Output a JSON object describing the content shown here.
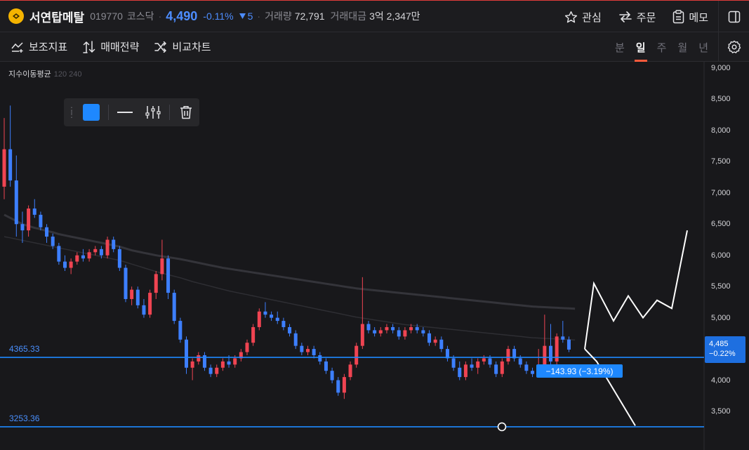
{
  "header": {
    "stock_name": "서연탑메탈",
    "stock_code": "019770",
    "market": "코스닥",
    "price": "4,490",
    "change_pct": "-0.11%",
    "change_val": "5",
    "volume_label": "거래량",
    "volume": "72,791",
    "amount_label": "거래대금",
    "amount": "3억 2,347만",
    "actions": {
      "watch": "관심",
      "order": "주문",
      "memo": "메모"
    }
  },
  "toolbar": {
    "indicators": "보조지표",
    "strategy": "매매전략",
    "compare": "비교차트",
    "periods": [
      "분",
      "일",
      "주",
      "월",
      "년"
    ],
    "active_period": "일"
  },
  "chart": {
    "indicator_name": "지수이동평균",
    "indicator_params": "120 240",
    "level_upper": "4365.33",
    "level_lower": "3253.36",
    "current_price": "4,485",
    "current_pct": "−0.22%",
    "measure": "−143.93 (−3.19%)",
    "draw_color": "#1e88ff"
  },
  "chart_data": {
    "type": "candlestick",
    "y_ticks": [
      "9,000",
      "8,500",
      "8,000",
      "7,500",
      "7,000",
      "6,500",
      "6,000",
      "5,500",
      "5,000",
      "4,500",
      "4,000",
      "3,500"
    ],
    "ylim": [
      3200,
      9000
    ],
    "up_color": "#f04452",
    "down_color": "#3d7fff",
    "candles": [
      [
        7100,
        8200,
        6900,
        7700
      ],
      [
        7700,
        8400,
        7100,
        7200
      ],
      [
        7200,
        7600,
        6300,
        6500
      ],
      [
        6500,
        6700,
        6200,
        6400
      ],
      [
        6400,
        6800,
        6300,
        6750
      ],
      [
        6750,
        6900,
        6600,
        6650
      ],
      [
        6650,
        6700,
        6400,
        6450
      ],
      [
        6450,
        6500,
        6200,
        6300
      ],
      [
        6300,
        6350,
        6100,
        6150
      ],
      [
        6150,
        6200,
        5850,
        5900
      ],
      [
        5900,
        6000,
        5750,
        5800
      ],
      [
        5800,
        5950,
        5700,
        5900
      ],
      [
        5900,
        6050,
        5850,
        6000
      ],
      [
        6000,
        6100,
        5900,
        5950
      ],
      [
        5950,
        6100,
        5900,
        6050
      ],
      [
        6050,
        6150,
        6000,
        6100
      ],
      [
        6100,
        6150,
        5950,
        6000
      ],
      [
        6000,
        6300,
        5950,
        6250
      ],
      [
        6250,
        6300,
        6050,
        6100
      ],
      [
        6100,
        6150,
        5750,
        5800
      ],
      [
        5800,
        5850,
        5250,
        5300
      ],
      [
        5300,
        5500,
        5200,
        5450
      ],
      [
        5450,
        5500,
        5150,
        5200
      ],
      [
        5200,
        5300,
        5000,
        5050
      ],
      [
        5050,
        5450,
        5000,
        5400
      ],
      [
        5400,
        5750,
        5300,
        5700
      ],
      [
        5700,
        6250,
        5600,
        5950
      ],
      [
        5950,
        6000,
        5300,
        5400
      ],
      [
        5400,
        5450,
        4900,
        4950
      ],
      [
        4950,
        5000,
        4600,
        4650
      ],
      [
        4650,
        4700,
        4100,
        4200
      ],
      [
        4200,
        4350,
        4000,
        4300
      ],
      [
        4300,
        4450,
        4250,
        4400
      ],
      [
        4400,
        4450,
        4150,
        4200
      ],
      [
        4200,
        4250,
        4050,
        4100
      ],
      [
        4100,
        4250,
        4050,
        4200
      ],
      [
        4200,
        4350,
        4150,
        4300
      ],
      [
        4300,
        4400,
        4200,
        4250
      ],
      [
        4250,
        4400,
        4200,
        4350
      ],
      [
        4350,
        4500,
        4300,
        4450
      ],
      [
        4450,
        4650,
        4400,
        4600
      ],
      [
        4600,
        4900,
        4550,
        4850
      ],
      [
        4850,
        5150,
        4800,
        5100
      ],
      [
        5100,
        5250,
        5000,
        5050
      ],
      [
        5050,
        5100,
        4950,
        5000
      ],
      [
        5000,
        5100,
        4900,
        4950
      ],
      [
        4950,
        5000,
        4800,
        4850
      ],
      [
        4850,
        4900,
        4700,
        4750
      ],
      [
        4750,
        4800,
        4500,
        4550
      ],
      [
        4550,
        4600,
        4400,
        4450
      ],
      [
        4450,
        4550,
        4400,
        4500
      ],
      [
        4500,
        4550,
        4350,
        4400
      ],
      [
        4400,
        4450,
        4250,
        4300
      ],
      [
        4300,
        4350,
        4100,
        4150
      ],
      [
        4150,
        4200,
        3950,
        4000
      ],
      [
        4000,
        4050,
        3750,
        3800
      ],
      [
        3800,
        4100,
        3700,
        4050
      ],
      [
        4050,
        4300,
        4000,
        4250
      ],
      [
        4250,
        4600,
        4200,
        4550
      ],
      [
        4550,
        5650,
        4500,
        4900
      ],
      [
        4900,
        4950,
        4750,
        4800
      ],
      [
        4800,
        4850,
        4700,
        4750
      ],
      [
        4750,
        4850,
        4700,
        4800
      ],
      [
        4800,
        4900,
        4750,
        4850
      ],
      [
        4850,
        4900,
        4750,
        4800
      ],
      [
        4800,
        4850,
        4650,
        4700
      ],
      [
        4700,
        4850,
        4650,
        4800
      ],
      [
        4800,
        4900,
        4750,
        4850
      ],
      [
        4850,
        4900,
        4750,
        4800
      ],
      [
        4800,
        4850,
        4700,
        4750
      ],
      [
        4750,
        4800,
        4550,
        4600
      ],
      [
        4600,
        4700,
        4550,
        4650
      ],
      [
        4650,
        4700,
        4450,
        4500
      ],
      [
        4500,
        4550,
        4300,
        4350
      ],
      [
        4350,
        4400,
        4150,
        4200
      ],
      [
        4200,
        4300,
        4000,
        4050
      ],
      [
        4050,
        4300,
        4000,
        4250
      ],
      [
        4250,
        4350,
        4150,
        4200
      ],
      [
        4200,
        4350,
        4100,
        4300
      ],
      [
        4300,
        4400,
        4250,
        4350
      ],
      [
        4350,
        4400,
        4200,
        4250
      ],
      [
        4250,
        4300,
        4050,
        4100
      ],
      [
        4100,
        4350,
        4050,
        4300
      ],
      [
        4300,
        4550,
        4250,
        4500
      ],
      [
        4500,
        4550,
        4300,
        4350
      ],
      [
        4350,
        4400,
        4200,
        4250
      ],
      [
        4250,
        4300,
        4100,
        4150
      ],
      [
        4150,
        4200,
        4050,
        4100
      ],
      [
        4100,
        4500,
        4050,
        4200
      ],
      [
        4200,
        5050,
        4150,
        4550
      ],
      [
        4550,
        4900,
        4200,
        4300
      ],
      [
        4300,
        4750,
        4250,
        4700
      ],
      [
        4700,
        4950,
        4600,
        4650
      ],
      [
        4650,
        4700,
        4450,
        4490
      ]
    ],
    "ema120": [
      6650,
      6600,
      6550,
      6500,
      6470,
      6440,
      6420,
      6390,
      6370,
      6340,
      6320,
      6300,
      6280,
      6260,
      6240,
      6220,
      6200,
      6180,
      6160,
      6140,
      6110,
      6080,
      6060,
      6040,
      6020,
      6000,
      5985,
      5970,
      5955,
      5940,
      5920,
      5900,
      5880,
      5860,
      5840,
      5820,
      5800,
      5785,
      5770,
      5755,
      5740,
      5725,
      5710,
      5695,
      5680,
      5665,
      5650,
      5635,
      5620,
      5605,
      5590,
      5575,
      5560,
      5545,
      5530,
      5515,
      5500,
      5485,
      5470,
      5460,
      5450,
      5440,
      5430,
      5420,
      5410,
      5400,
      5390,
      5380,
      5370,
      5360,
      5350,
      5340,
      5330,
      5320,
      5310,
      5300,
      5290,
      5280,
      5270,
      5260,
      5250,
      5240,
      5230,
      5220,
      5210,
      5200,
      5190,
      5180,
      5175,
      5170,
      5165,
      5160,
      5155,
      5150,
      5145
    ],
    "ema240": [
      6300,
      6280,
      6260,
      6240,
      6220,
      6200,
      6180,
      6160,
      6140,
      6120,
      6100,
      6080,
      6060,
      6040,
      6020,
      6000,
      5980,
      5960,
      5940,
      5920,
      5890,
      5860,
      5830,
      5800,
      5770,
      5740,
      5715,
      5690,
      5665,
      5640,
      5610,
      5580,
      5555,
      5530,
      5505,
      5480,
      5455,
      5430,
      5410,
      5390,
      5370,
      5350,
      5330,
      5310,
      5290,
      5270,
      5250,
      5230,
      5210,
      5190,
      5170,
      5150,
      5130,
      5110,
      5090,
      5070,
      5050,
      5030,
      5010,
      4995,
      4980,
      4965,
      4950,
      4935,
      4920,
      4905,
      4890,
      4880,
      4870,
      4860,
      4850,
      4840,
      4830,
      4820,
      4810,
      4800,
      4790,
      4780,
      4770,
      4760,
      4750,
      4740,
      4730,
      4720,
      4710,
      4700,
      4690,
      4680,
      4675,
      4670,
      4665,
      4660,
      4655,
      4650,
      4645
    ],
    "hlines": [
      4365.33,
      3253.36
    ],
    "projection": [
      [
        4500,
        4350
      ],
      [
        5550,
        3600
      ],
      [
        4950,
        3250
      ],
      [
        5350
      ],
      [
        5000
      ],
      [
        5300
      ],
      [
        5150
      ],
      [
        6400
      ]
    ]
  }
}
